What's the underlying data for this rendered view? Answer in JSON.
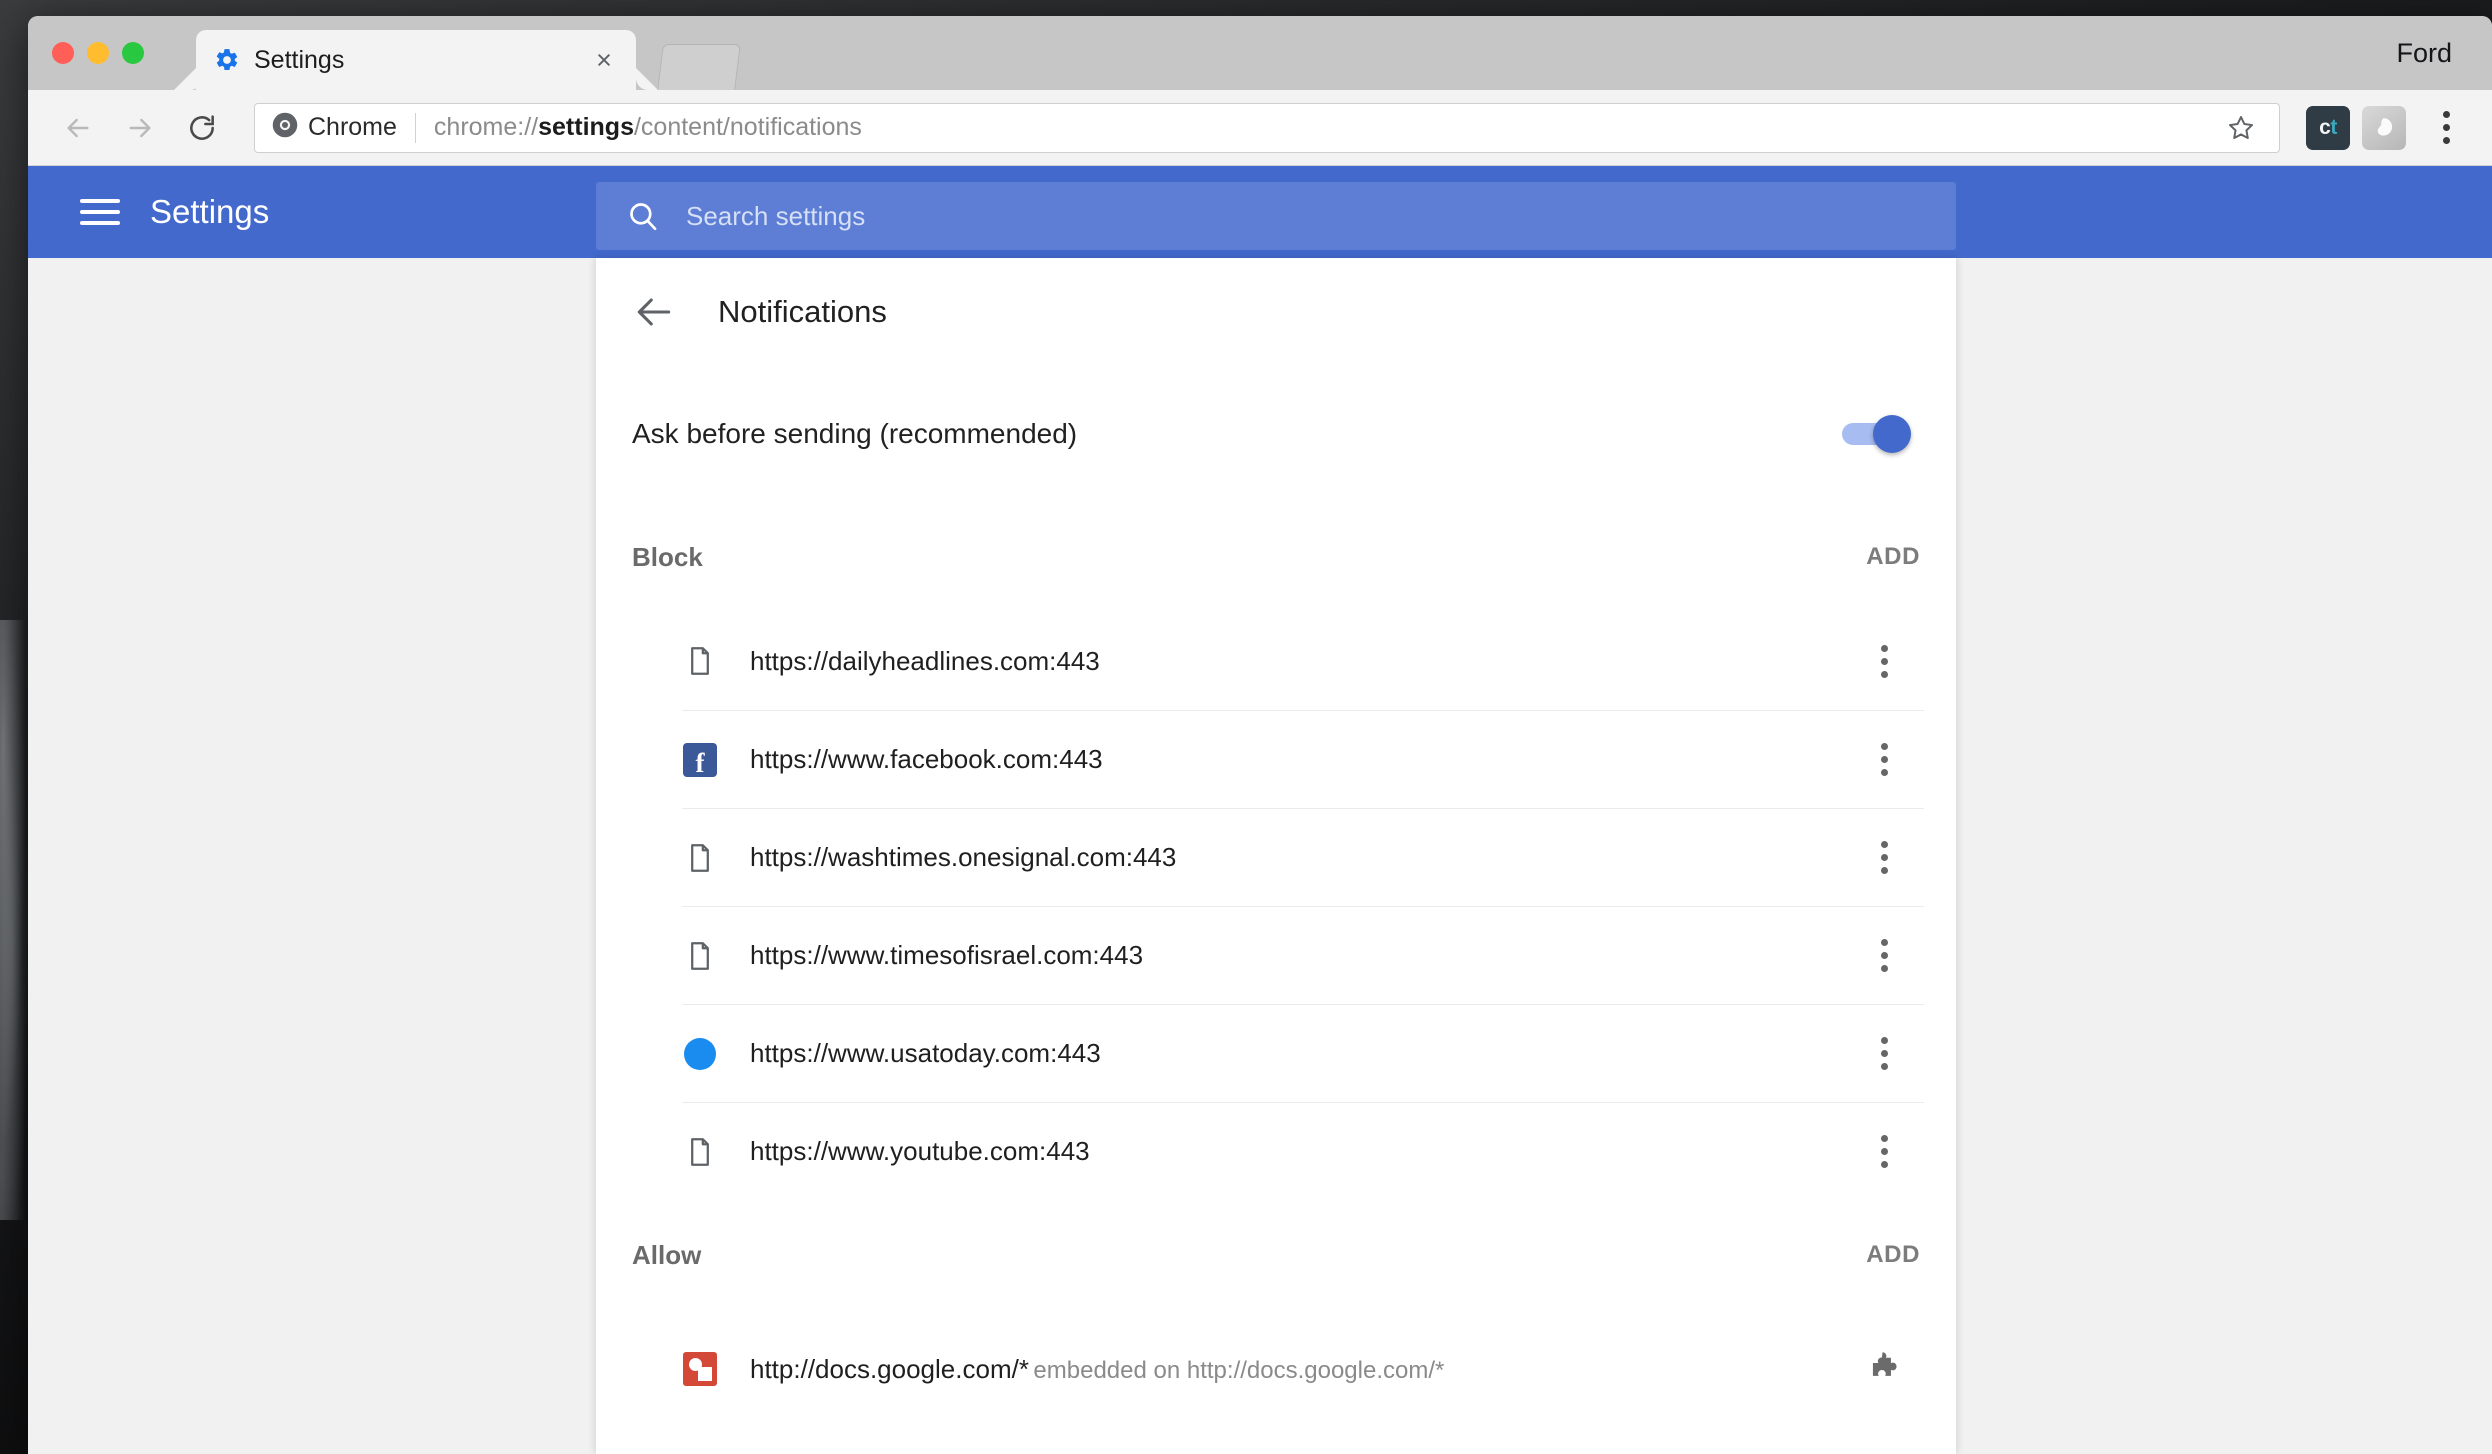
{
  "window": {
    "profile_name": "Ford",
    "traffic_lights": [
      "close",
      "minimize",
      "maximize"
    ]
  },
  "tabs": {
    "active": {
      "favicon": "gear-icon",
      "title": "Settings",
      "close_label": "×"
    },
    "background_placeholder": true
  },
  "toolbar": {
    "back_icon": "arrow-left-icon",
    "forward_icon": "arrow-right-icon",
    "reload_icon": "reload-icon",
    "chrome_chip_icon": "chrome-icon",
    "chrome_chip_label": "Chrome",
    "url_prefix": "chrome://",
    "url_bold": "settings",
    "url_suffix": "/content/notifications",
    "url_full": "chrome://settings/content/notifications",
    "bookmark_icon": "star-icon",
    "extensions": [
      {
        "name": "ct-extension-icon",
        "text_a": "c",
        "text_b": "t"
      },
      {
        "name": "generic-extension-icon"
      }
    ],
    "menu_icon": "kebab-menu-icon"
  },
  "settings_header": {
    "menu_icon": "hamburger-icon",
    "title": "Settings",
    "search": {
      "icon": "search-icon",
      "placeholder": "Search settings",
      "value": ""
    }
  },
  "page": {
    "back_icon": "arrow-left-icon",
    "title": "Notifications",
    "ask_before_sending": {
      "label": "Ask before sending (recommended)",
      "enabled": true
    },
    "sections": [
      {
        "id": "block",
        "title": "Block",
        "add_label": "ADD",
        "rows": [
          {
            "icon": "document-icon",
            "url": "https://dailyheadlines.com:443",
            "sub": "",
            "action": "kebab-menu-icon"
          },
          {
            "icon": "facebook-icon",
            "url": "https://www.facebook.com:443",
            "sub": "",
            "action": "kebab-menu-icon"
          },
          {
            "icon": "document-icon",
            "url": "https://washtimes.onesignal.com:443",
            "sub": "",
            "action": "kebab-menu-icon"
          },
          {
            "icon": "document-icon",
            "url": "https://www.timesofisrael.com:443",
            "sub": "",
            "action": "kebab-menu-icon"
          },
          {
            "icon": "blue-dot-icon",
            "url": "https://www.usatoday.com:443",
            "sub": "",
            "action": "kebab-menu-icon"
          },
          {
            "icon": "document-icon",
            "url": "https://www.youtube.com:443",
            "sub": "",
            "action": "kebab-menu-icon"
          }
        ]
      },
      {
        "id": "allow",
        "title": "Allow",
        "add_label": "ADD",
        "rows": [
          {
            "icon": "google-drawings-icon",
            "url": "http://docs.google.com/*",
            "sub": "embedded on http://docs.google.com/*",
            "action": "puzzle-piece-icon"
          }
        ]
      }
    ]
  },
  "colors": {
    "settings_accent": "#4369cd",
    "toggle_track": "#a7bcf0",
    "facebook_blue": "#3b5998",
    "usatoday_blue": "#1a8cf0",
    "drawings_red": "#d34836",
    "page_bg": "#f1f1f1"
  }
}
